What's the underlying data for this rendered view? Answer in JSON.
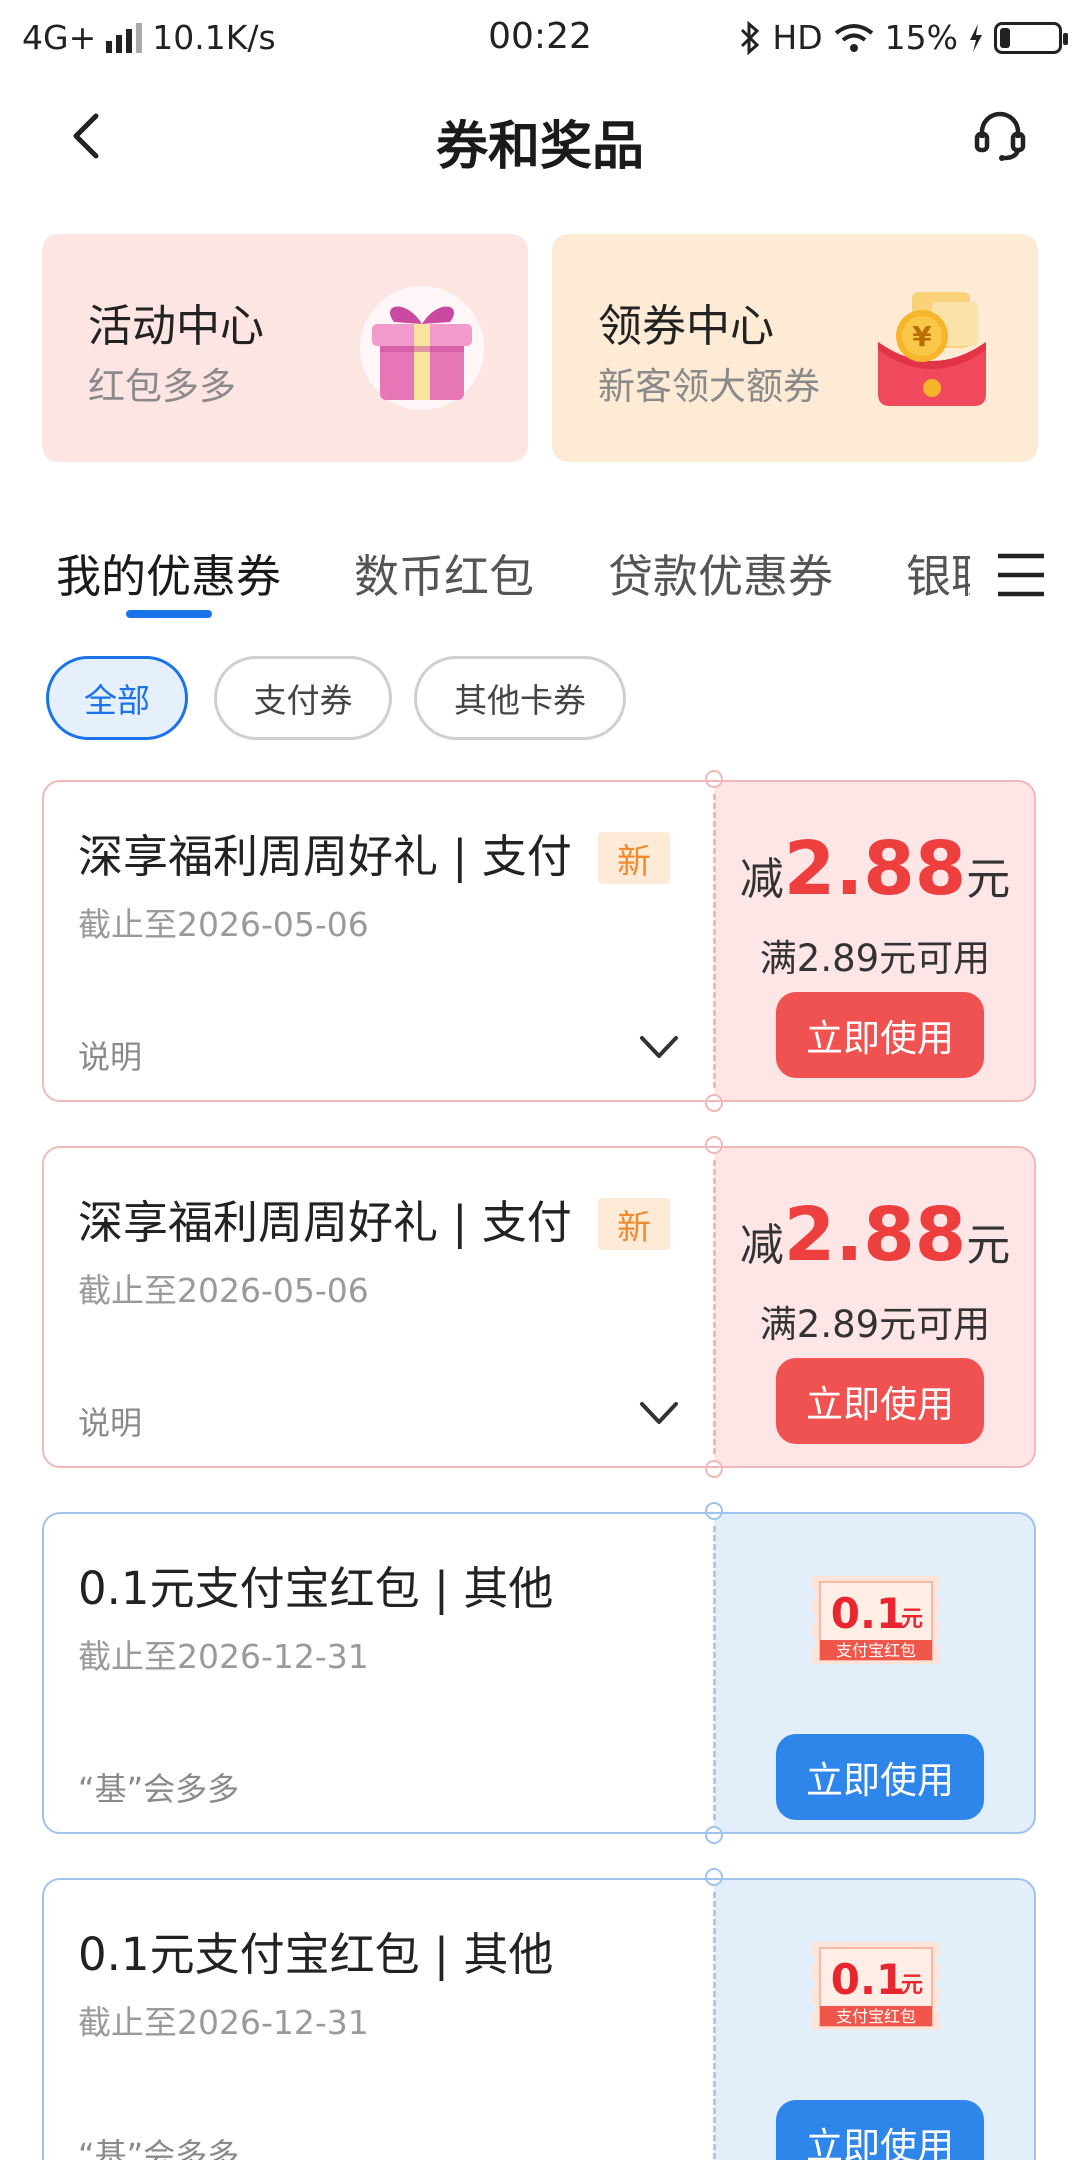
{
  "status_bar": {
    "network": "4G+",
    "speed": "10.1K/s",
    "time": "00:22",
    "hd": "HD",
    "battery": "15%"
  },
  "navbar": {
    "title": "券和奖品"
  },
  "banners": [
    {
      "title": "活动中心",
      "subtitle": "红包多多"
    },
    {
      "title": "领券中心",
      "subtitle": "新客领大额券"
    }
  ],
  "tabs": [
    "我的优惠券",
    "数币红包",
    "贷款优惠券",
    "银联"
  ],
  "active_tab": "我的优惠券",
  "filters": [
    "全部",
    "支付券",
    "其他卡券"
  ],
  "active_filter": "全部",
  "coupons": [
    {
      "name": "深享福利周周好礼 | 支付",
      "badge": "新",
      "date": "截止至2026-05-06",
      "note": "说明",
      "prefix": "减",
      "amount": "2.88",
      "suffix": "元",
      "condition": "满2.89元可用",
      "button": "立即使用"
    },
    {
      "name": "深享福利周周好礼 | 支付",
      "badge": "新",
      "date": "截止至2026-05-06",
      "note": "说明",
      "prefix": "减",
      "amount": "2.88",
      "suffix": "元",
      "condition": "满2.89元可用",
      "button": "立即使用"
    },
    {
      "name": "0.1元支付宝红包 |  其他",
      "date": "截止至2026-12-31",
      "note": "“基”会多多",
      "image_amount": "0.1",
      "image_unit": "元",
      "image_label": "支付宝红包",
      "button": "立即使用"
    },
    {
      "name": "0.1元支付宝红包 |  其他",
      "date": "截止至2026-12-31",
      "note": "“基”会多多",
      "image_amount": "0.1",
      "image_unit": "元",
      "image_label": "支付宝红包",
      "button": "立即使用"
    }
  ],
  "colors": {
    "accent_blue": "#1a73e8",
    "coupon_red": "#ee3f3f",
    "button_red": "#f05252",
    "button_blue": "#2f86ea"
  }
}
